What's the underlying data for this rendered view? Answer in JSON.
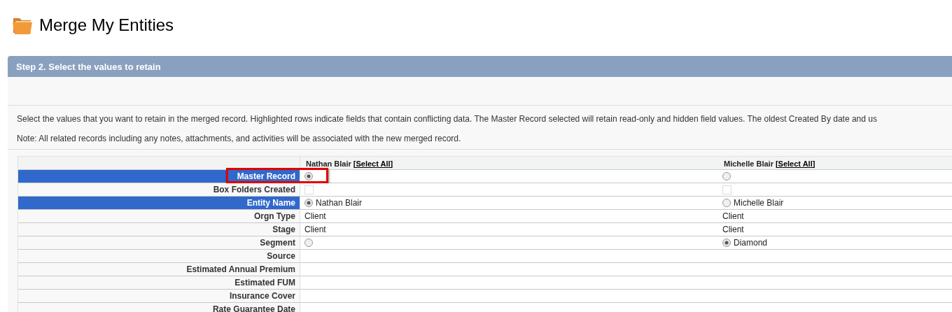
{
  "page": {
    "title": "Merge My Entities"
  },
  "step": {
    "title": "Step 2. Select the values to retain",
    "instructions": "Select the values that you want to retain in the merged record. Highlighted rows indicate fields that contain conflicting data. The Master Record selected will retain read-only and hidden field values. The oldest Created By date and us",
    "note": "Note: All related records including any notes, attachments, and activities will be associated with the new merged record."
  },
  "table": {
    "columns": [
      {
        "name": "Nathan Blair",
        "link": "[Select All]"
      },
      {
        "name": "Michelle Blair",
        "link": "[Select All]"
      }
    ],
    "rows": [
      {
        "label": "Master Record",
        "highlighted": true,
        "annotated": true,
        "cells": [
          {
            "kind": "radio",
            "selected": true
          },
          {
            "kind": "radio",
            "selected": false
          }
        ]
      },
      {
        "label": "Box Folders Created",
        "highlighted": false,
        "annotated": false,
        "cells": [
          {
            "kind": "checkbox",
            "disabled": true
          },
          {
            "kind": "checkbox",
            "disabled": true
          }
        ]
      },
      {
        "label": "Entity Name",
        "highlighted": true,
        "annotated": false,
        "cells": [
          {
            "kind": "radio",
            "selected": true,
            "text": "Nathan Blair"
          },
          {
            "kind": "radio",
            "selected": false,
            "text": "Michelle Blair"
          }
        ]
      },
      {
        "label": "Orgn Type",
        "highlighted": false,
        "annotated": false,
        "cells": [
          {
            "kind": "text",
            "text": "Client"
          },
          {
            "kind": "text",
            "text": "Client"
          }
        ]
      },
      {
        "label": "Stage",
        "highlighted": false,
        "annotated": false,
        "cells": [
          {
            "kind": "text",
            "text": "Client"
          },
          {
            "kind": "text",
            "text": "Client"
          }
        ]
      },
      {
        "label": "Segment",
        "highlighted": false,
        "annotated": false,
        "cells": [
          {
            "kind": "radio",
            "selected": false
          },
          {
            "kind": "radio",
            "selected": true,
            "text": "Diamond"
          }
        ]
      },
      {
        "label": "Source",
        "highlighted": false,
        "annotated": false,
        "cells": [
          {
            "kind": "text"
          },
          {
            "kind": "text"
          }
        ]
      },
      {
        "label": "Estimated Annual Premium",
        "highlighted": false,
        "annotated": false,
        "cells": [
          {
            "kind": "text"
          },
          {
            "kind": "text"
          }
        ]
      },
      {
        "label": "Estimated FUM",
        "highlighted": false,
        "annotated": false,
        "cells": [
          {
            "kind": "text"
          },
          {
            "kind": "text"
          }
        ]
      },
      {
        "label": "Insurance Cover",
        "highlighted": false,
        "annotated": false,
        "cells": [
          {
            "kind": "text"
          },
          {
            "kind": "text"
          }
        ]
      },
      {
        "label": "Rate Guarantee Date",
        "highlighted": false,
        "annotated": false,
        "cells": [
          {
            "kind": "text"
          },
          {
            "kind": "text"
          }
        ]
      }
    ]
  }
}
